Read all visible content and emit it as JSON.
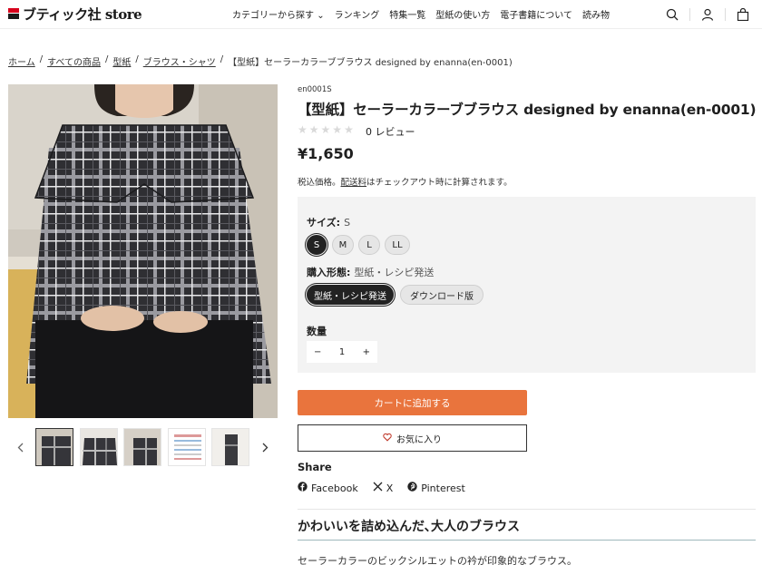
{
  "header": {
    "logo_text": "ブティック社 store",
    "nav": [
      "カテゴリーから探す",
      "ランキング",
      "特集一覧",
      "型紙の使い方",
      "電子書籍について",
      "読み物"
    ],
    "nav_caret": "⌄",
    "icons": [
      "search-icon",
      "user-icon",
      "cart-icon"
    ]
  },
  "breadcrumb": {
    "items": [
      "ホーム",
      "すべての商品",
      "型紙",
      "ブラウス・シャツ",
      "【型紙】セーラーカラーブブラウス designed by enanna(en-0001)"
    ],
    "separator": "/"
  },
  "product": {
    "sku": "en0001S",
    "title": "【型紙】セーラーカラーブブラウス designed by enanna(en-0001)",
    "review_count": "0 レビュー",
    "rating": 0,
    "price": "¥1,650",
    "tax_note_pre": "税込価格。",
    "tax_note_link": "配送料",
    "tax_note_post": "はチェックアウト時に計算されます。"
  },
  "options": {
    "size_label": "サイズ:",
    "size_value": "S",
    "sizes": [
      "S",
      "M",
      "L",
      "LL"
    ],
    "purchase_label": "購入形態:",
    "purchase_value": "型紙・レシピ発送",
    "purchase_options": [
      "型紙・レシピ発送",
      "ダウンロード版"
    ],
    "qty_label": "数量",
    "qty_minus": "−",
    "qty_value": "1",
    "qty_plus": "+"
  },
  "actions": {
    "add_to_cart": "カートに追加する",
    "favorite": "お気に入り"
  },
  "share": {
    "title": "Share",
    "items": [
      "Facebook",
      "X",
      "Pinterest"
    ]
  },
  "section": {
    "title": "かわいいを詰め込んだ､大人のブラウス",
    "description": "セーラーカラーのビックシルエットの衿が印象的なブラウス。"
  },
  "colors": {
    "accent": "#e9743d",
    "logo_red": "#d7001c"
  }
}
